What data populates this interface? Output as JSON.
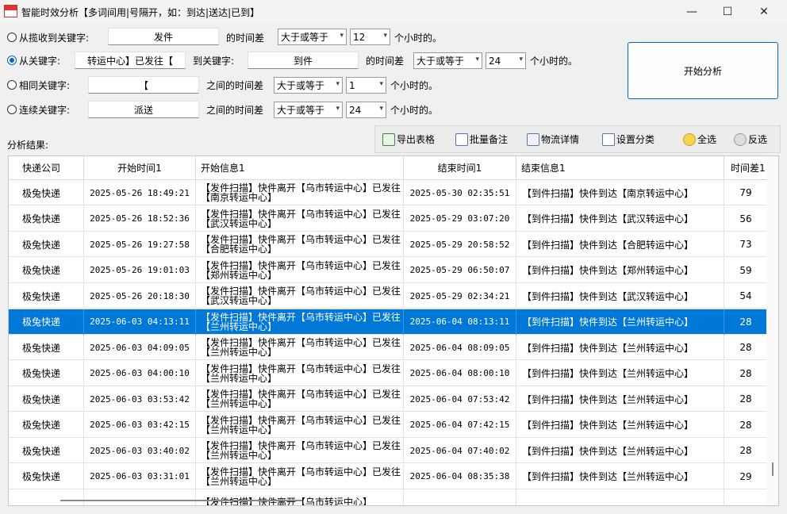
{
  "window": {
    "title": "智能时效分析【多词间用|号隔开，如：到达|送达|已到】",
    "minimize": "—",
    "maximize": "☐",
    "close": "✕"
  },
  "filters": {
    "row1": {
      "label": "从揽收到关键字:",
      "keyword": "发件",
      "diff_label": "的时间差",
      "op": "大于或等于",
      "hours": "12",
      "unit": "个小时的。",
      "selected": false
    },
    "row2": {
      "label": "从关键字:",
      "keyword": "转运中心】已发往【",
      "to_label": "到关键字:",
      "keyword2": "到件",
      "diff_label": "的时间差",
      "op": "大于或等于",
      "hours": "24",
      "unit": "个小时的。",
      "selected": true
    },
    "row3": {
      "label": "相同关键字:",
      "keyword": "【",
      "diff_label": "之间的时间差",
      "op": "大于或等于",
      "hours": "1",
      "unit": "个小时的。",
      "selected": false
    },
    "row4": {
      "label": "连续关键字:",
      "keyword": "派送",
      "diff_label": "之间的时间差",
      "op": "大于或等于",
      "hours": "24",
      "unit": "个小时的。",
      "selected": false
    }
  },
  "start_button": "开始分析",
  "results_label": "分析结果:",
  "toolbar": {
    "export": "导出表格",
    "batch_note": "批量备注",
    "logistics": "物流详情",
    "set_category": "设置分类",
    "select_all": "全选",
    "invert": "反选"
  },
  "table": {
    "headers": [
      "快递公司",
      "开始时间1",
      "开始信息1",
      "结束时间1",
      "结束信息1",
      "时间差1"
    ],
    "rows": [
      {
        "company": "极兔快递",
        "start_time": "2025-05-26 18:49:21",
        "start_info": "【发件扫描】快件离开【乌市转运中心】已发往【南京转运中心】",
        "end_time": "2025-05-30 02:35:51",
        "end_info": "【到件扫描】快件到达【南京转运中心】",
        "diff": "79"
      },
      {
        "company": "极兔快递",
        "start_time": "2025-05-26 18:52:36",
        "start_info": "【发件扫描】快件离开【乌市转运中心】已发往【武汉转运中心】",
        "end_time": "2025-05-29 03:07:20",
        "end_info": "【到件扫描】快件到达【武汉转运中心】",
        "diff": "56"
      },
      {
        "company": "极兔快递",
        "start_time": "2025-05-26 19:27:58",
        "start_info": "【发件扫描】快件离开【乌市转运中心】已发往【合肥转运中心】",
        "end_time": "2025-05-29 20:58:52",
        "end_info": "【到件扫描】快件到达【合肥转运中心】",
        "diff": "73"
      },
      {
        "company": "极兔快递",
        "start_time": "2025-05-26 19:01:03",
        "start_info": "【发件扫描】快件离开【乌市转运中心】已发往【郑州转运中心】",
        "end_time": "2025-05-29 06:50:07",
        "end_info": "【到件扫描】快件到达【郑州转运中心】",
        "diff": "59"
      },
      {
        "company": "极兔快递",
        "start_time": "2025-05-26 20:18:30",
        "start_info": "【发件扫描】快件离开【乌市转运中心】已发往【武汉转运中心】",
        "end_time": "2025-05-29 02:34:21",
        "end_info": "【到件扫描】快件到达【武汉转运中心】",
        "diff": "54"
      },
      {
        "company": "极兔快递",
        "start_time": "2025-06-03 04:13:11",
        "start_info": "【发件扫描】快件离开【乌市转运中心】已发往【兰州转运中心】",
        "end_time": "2025-06-04 08:13:11",
        "end_info": "【到件扫描】快件到达【兰州转运中心】",
        "diff": "28",
        "selected": true
      },
      {
        "company": "极兔快递",
        "start_time": "2025-06-03 04:09:05",
        "start_info": "【发件扫描】快件离开【乌市转运中心】已发往【兰州转运中心】",
        "end_time": "2025-06-04 08:09:05",
        "end_info": "【到件扫描】快件到达【兰州转运中心】",
        "diff": "28"
      },
      {
        "company": "极兔快递",
        "start_time": "2025-06-03 04:00:10",
        "start_info": "【发件扫描】快件离开【乌市转运中心】已发往【兰州转运中心】",
        "end_time": "2025-06-04 08:00:10",
        "end_info": "【到件扫描】快件到达【兰州转运中心】",
        "diff": "28"
      },
      {
        "company": "极兔快递",
        "start_time": "2025-06-03 03:53:42",
        "start_info": "【发件扫描】快件离开【乌市转运中心】已发往【兰州转运中心】",
        "end_time": "2025-06-04 07:53:42",
        "end_info": "【到件扫描】快件到达【兰州转运中心】",
        "diff": "28"
      },
      {
        "company": "极兔快递",
        "start_time": "2025-06-03 03:42:15",
        "start_info": "【发件扫描】快件离开【乌市转运中心】已发往【兰州转运中心】",
        "end_time": "2025-06-04 07:42:15",
        "end_info": "【到件扫描】快件到达【兰州转运中心】",
        "diff": "28"
      },
      {
        "company": "极兔快递",
        "start_time": "2025-06-03 03:40:02",
        "start_info": "【发件扫描】快件离开【乌市转运中心】已发往【兰州转运中心】",
        "end_time": "2025-06-04 07:40:02",
        "end_info": "【到件扫描】快件到达【兰州转运中心】",
        "diff": "28"
      },
      {
        "company": "极兔快递",
        "start_time": "2025-06-03 03:31:01",
        "start_info": "【发件扫描】快件离开【乌市转运中心】已发往【兰州转运中心】",
        "end_time": "2025-06-04 08:35:38",
        "end_info": "【到件扫描】快件到达【兰州转运中心】",
        "diff": "29"
      },
      {
        "company": "",
        "start_time": "",
        "start_info": "【发件扫描】快件离开【乌市转运中心】",
        "end_time": "",
        "end_info": "",
        "diff": ""
      }
    ]
  }
}
